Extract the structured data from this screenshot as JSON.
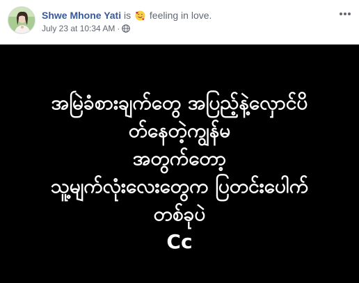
{
  "post": {
    "author_name": "Shwe Mhone Yati",
    "is_word": "is",
    "feeling_text": "feeling in love.",
    "timestamp": "July 23 at 10:34 AM",
    "separator": "·",
    "privacy_icon": "globe-icon",
    "more_icon": "more-options-icon",
    "feeling_icon": "smiling-face-with-hearts-icon",
    "colors": {
      "name": "#385898",
      "meta": "#616770",
      "background": "#000000",
      "text": "#ffffff"
    }
  },
  "status": {
    "lines": [
      "အမြဲခံစားချက်တွေ အပြည့်နဲ့လှောင်ပိ",
      "တ်နေတဲ့ကျွန်မ",
      "အတွက်တော့",
      "သူ့မျက်လုံးလေးတွေက ပြတင်းပေါက်",
      "တစ်ခုပဲ",
      "Cc"
    ]
  }
}
